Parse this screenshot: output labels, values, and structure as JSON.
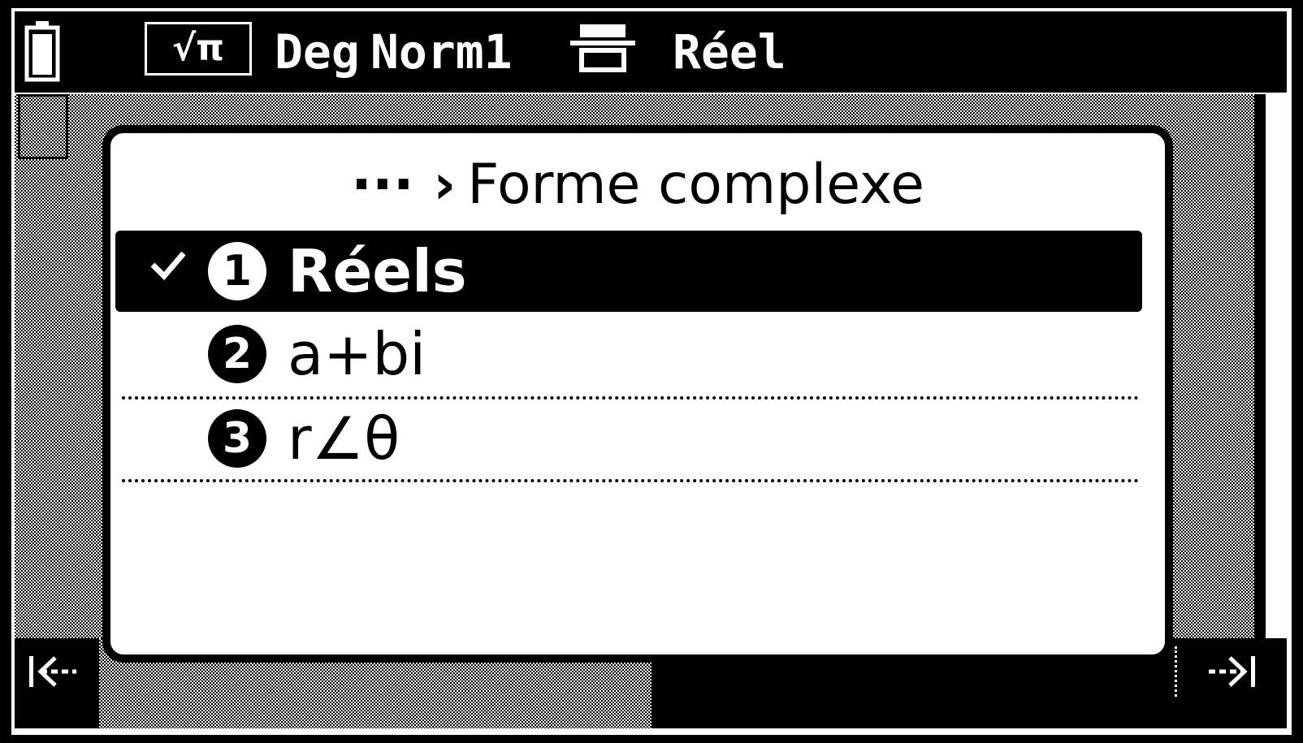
{
  "status_bar": {
    "battery_icon": "battery-icon",
    "input_mode": "√π",
    "angle_unit": "Deg",
    "display_format": "Norm1",
    "table_icon": "table-icon",
    "complex_mode": "Réel"
  },
  "dialog": {
    "breadcrumb": "··· ›",
    "title": "Forme complexe",
    "options": [
      {
        "number": "1",
        "label": "Réels",
        "selected": true
      },
      {
        "number": "2",
        "label": "a+bi",
        "selected": false
      },
      {
        "number": "3",
        "label": "r∠θ",
        "selected": false
      }
    ]
  },
  "bottom_bar": {
    "left_icon": "nav-first-icon",
    "right_icon": "nav-last-icon"
  },
  "colors": {
    "foreground": "#000000",
    "background": "#ffffff"
  }
}
